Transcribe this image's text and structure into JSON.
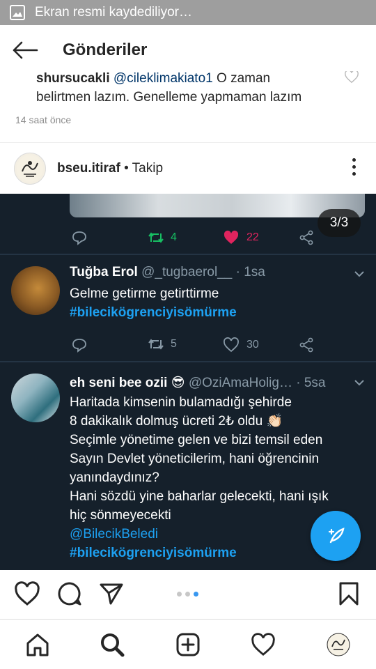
{
  "status_bar": {
    "notification": "Ekran resmi kaydediliyor…",
    "icon": "image-icon"
  },
  "app_bar": {
    "title": "Gönderiler",
    "back_icon": "arrow-left-icon"
  },
  "comment": {
    "username": "shursucakli",
    "mention": "@cileklimakiato1",
    "text_part1": " O zaman",
    "text_line2": "belirtmen lazım. Genelleme yapmaman lazım",
    "time": "14 saat önce"
  },
  "post_header": {
    "username": "bseu.itiraf",
    "follow": "• Takip",
    "more_icon": "more-vertical-icon"
  },
  "media": {
    "counter": "3/3",
    "top_tweet_actions": {
      "retweets": "4",
      "likes": "22"
    },
    "tweets": [
      {
        "name": "Tuğba Erol",
        "handle": "@_tugbaerol__ · 1sa",
        "text": "Gelme getirme getirttirme",
        "hashtag": "#bilecikögrenciyisömürme",
        "retweets": "5",
        "likes": "30"
      },
      {
        "name": "eh seni bee ozii 😎",
        "handle": "@OziAmaHolig… · 5sa",
        "lines": [
          "Haritada kimsenin bulamadığı şehirde",
          "8 dakikalık dolmuş ücreti 2₺ oldu 👏🏻",
          "Seçimle yönetime gelen ve bizi temsil eden",
          "Sayın Devlet yöneticilerim, hani öğrencinin",
          "yanındaydınız?",
          "Hani sözdü yine baharlar gelecekti, hani ışık",
          "hiç sönmeyecekti"
        ],
        "mention": "@BilecikBeledi",
        "hashtag": "#bilecikögrenciyisömürme"
      }
    ]
  },
  "colors": {
    "twitter_bg": "#15202b",
    "twitter_blue": "#1da1f2",
    "like_red": "#e0245e",
    "retweet_green": "#17bf63"
  }
}
